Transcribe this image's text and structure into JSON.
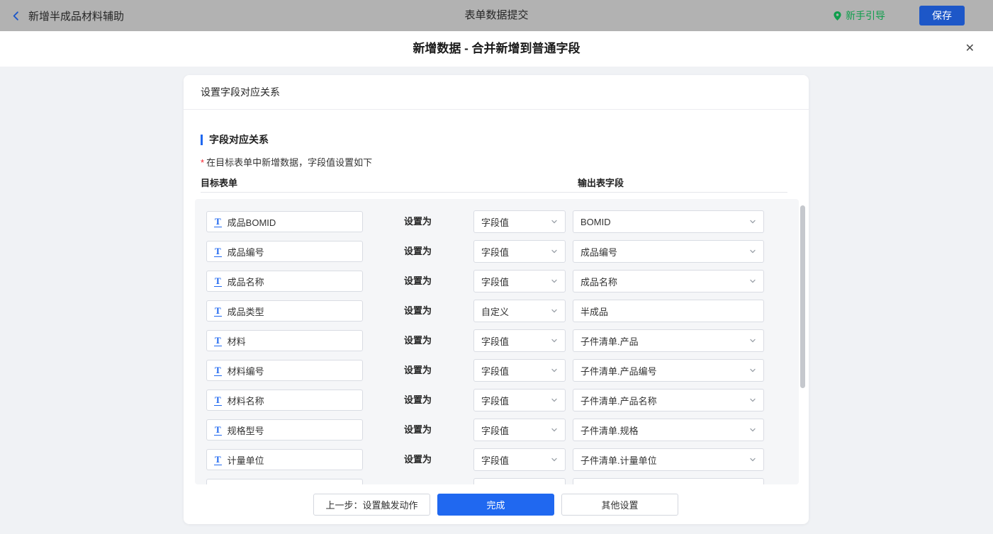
{
  "colors": {
    "topbar_bg": "#b2b2b2",
    "page_bg": "#f0f2f5",
    "accent_blue": "#2068f0",
    "save_blue": "#1d57c8",
    "guide_green": "#0f9e4c",
    "danger_red": "#f5222d",
    "list_bg": "#f5f6f8"
  },
  "topbar": {
    "back_label": "新增半成品材料辅助",
    "center_title": "表单数据提交",
    "guide_label": "新手引导",
    "save_label": "保存"
  },
  "modal": {
    "title": "新增数据 - 合并新增到普通字段",
    "close_glyph": "✕"
  },
  "card": {
    "header": "设置字段对应关系",
    "section_title": "字段对应关系",
    "hint_asterisk": "*",
    "hint_text": "在目标表单中新增数据，字段值设置如下",
    "col_left": "目标表单",
    "col_right": "输出表字段"
  },
  "icons": {
    "text_field_glyph": "T"
  },
  "rows": [
    {
      "field": "成品BOMID",
      "set_label": "设置为",
      "mode": "字段值",
      "value": "BOMID",
      "mode_is_dropdown": true,
      "value_is_dropdown": true
    },
    {
      "field": "成品编号",
      "set_label": "设置为",
      "mode": "字段值",
      "value": "成品编号",
      "mode_is_dropdown": true,
      "value_is_dropdown": true
    },
    {
      "field": "成品名称",
      "set_label": "设置为",
      "mode": "字段值",
      "value": "成品名称",
      "mode_is_dropdown": true,
      "value_is_dropdown": true
    },
    {
      "field": "成品类型",
      "set_label": "设置为",
      "mode": "自定义",
      "value": "半成品",
      "mode_is_dropdown": true,
      "value_is_dropdown": false
    },
    {
      "field": "材料",
      "set_label": "设置为",
      "mode": "字段值",
      "value": "子件清单.产品",
      "mode_is_dropdown": true,
      "value_is_dropdown": true
    },
    {
      "field": "材料编号",
      "set_label": "设置为",
      "mode": "字段值",
      "value": "子件清单.产品编号",
      "mode_is_dropdown": true,
      "value_is_dropdown": true
    },
    {
      "field": "材料名称",
      "set_label": "设置为",
      "mode": "字段值",
      "value": "子件清单.产品名称",
      "mode_is_dropdown": true,
      "value_is_dropdown": true
    },
    {
      "field": "规格型号",
      "set_label": "设置为",
      "mode": "字段值",
      "value": "子件清单.规格",
      "mode_is_dropdown": true,
      "value_is_dropdown": true
    },
    {
      "field": "计量单位",
      "set_label": "设置为",
      "mode": "字段值",
      "value": "子件清单.计量单位",
      "mode_is_dropdown": true,
      "value_is_dropdown": true
    },
    {
      "field": "",
      "set_label": "",
      "mode": "",
      "value": "",
      "mode_is_dropdown": false,
      "value_is_dropdown": false
    }
  ],
  "footer": {
    "prev_label": "上一步：设置触发动作",
    "done_label": "完成",
    "other_label": "其他设置"
  }
}
